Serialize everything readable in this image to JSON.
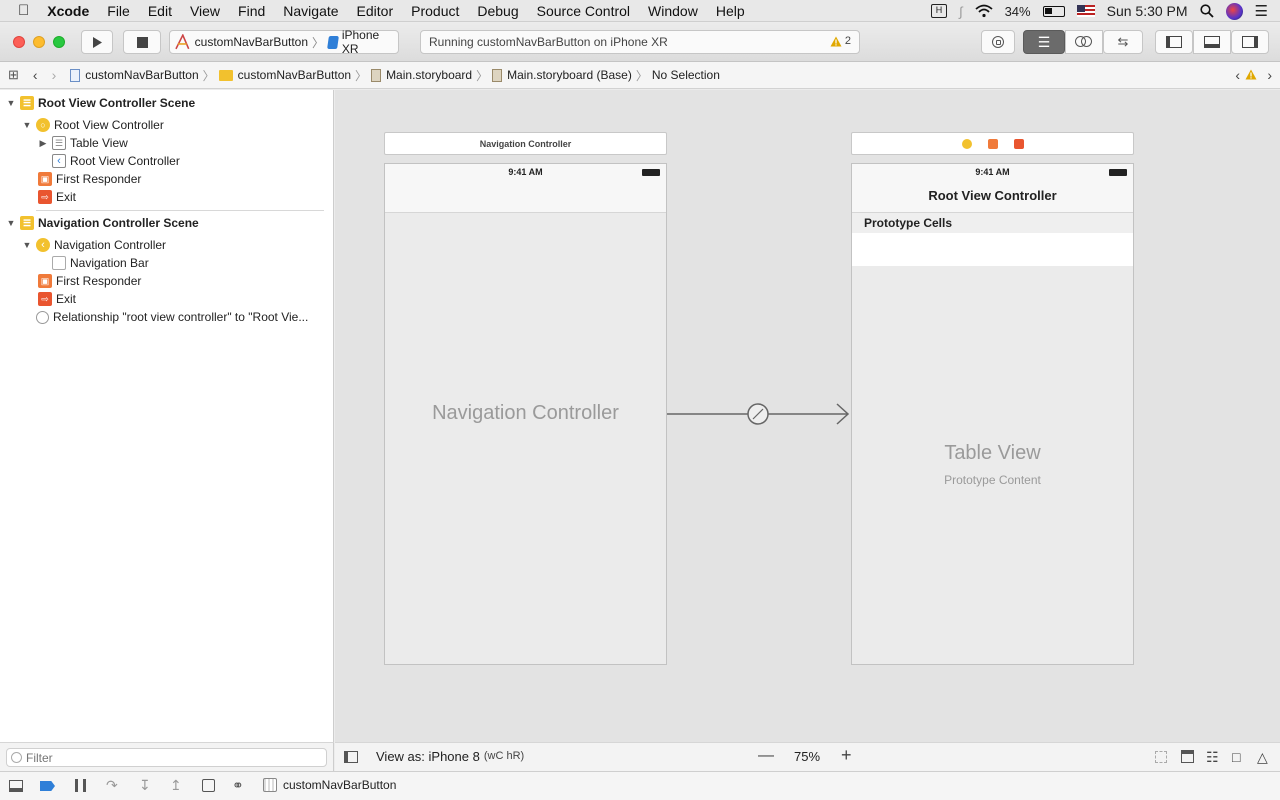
{
  "menubar": {
    "app": "Xcode",
    "items": [
      "File",
      "Edit",
      "View",
      "Find",
      "Navigate",
      "Editor",
      "Product",
      "Debug",
      "Source Control",
      "Window",
      "Help"
    ],
    "battery": "34%",
    "clock": "Sun 5:30 PM"
  },
  "toolbar": {
    "scheme": "customNavBarButton",
    "device": "iPhone XR",
    "status": "Running customNavBarButton on iPhone XR",
    "warnings": "2"
  },
  "pathbar": {
    "crumbs": [
      "customNavBarButton",
      "customNavBarButton",
      "Main.storyboard",
      "Main.storyboard (Base)",
      "No Selection"
    ]
  },
  "navigator": {
    "scene1": {
      "title": "Root View Controller Scene",
      "controller": "Root View Controller",
      "table_view": "Table View",
      "nav_item": "Root View Controller",
      "first_responder": "First Responder",
      "exit": "Exit"
    },
    "scene2": {
      "title": "Navigation Controller Scene",
      "controller": "Navigation Controller",
      "nav_bar": "Navigation Bar",
      "first_responder": "First Responder",
      "exit": "Exit",
      "relationship": "Relationship \"root view controller\" to \"Root Vie..."
    },
    "filter_placeholder": "Filter"
  },
  "canvas": {
    "nav_scene_header": "Navigation Controller",
    "nav_time": "9:41 AM",
    "nav_placeholder": "Navigation Controller",
    "root_time": "9:41 AM",
    "root_title": "Root View Controller",
    "prototype_cells": "Prototype Cells",
    "table_view": "Table View",
    "prototype_content": "Prototype Content"
  },
  "canvasbar": {
    "view_as": "View as: iPhone 8",
    "size_class": "(wC hR)",
    "zoom": "75%"
  },
  "debugbar": {
    "target": "customNavBarButton"
  },
  "colors": {
    "accent": "#1a73e8",
    "warning": "#e0a800",
    "scene_yellow": "#f2c12e",
    "responder_orange": "#f07a3a",
    "exit_red": "#e9552f"
  }
}
